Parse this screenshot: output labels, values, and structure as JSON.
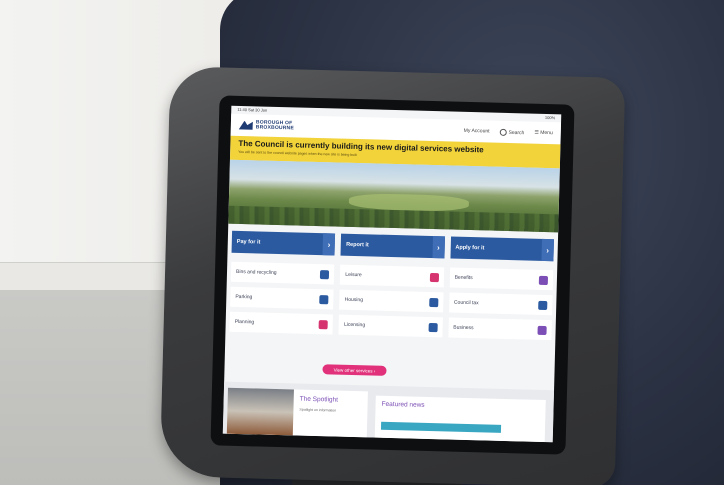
{
  "status": {
    "time": "11:40 Sat 30 Jun",
    "battery": "100%"
  },
  "header": {
    "logo_line1": "BOROUGH OF",
    "logo_line2": "BROXBOURNE",
    "nav": [
      "My Account",
      "Search",
      "Menu"
    ]
  },
  "banner": {
    "title": "The Council is currently building its new digital services website",
    "subtitle": "You will be sent to the council website pages when the new site is being built"
  },
  "actions": [
    "Pay for it",
    "Report it",
    "Apply for it"
  ],
  "services": [
    {
      "label": "Bins and recycling",
      "icon": "bin-icon"
    },
    {
      "label": "Leisure",
      "icon": "swimmer-icon"
    },
    {
      "label": "Benefits",
      "icon": "piggy-bank-icon"
    },
    {
      "label": "Parking",
      "icon": "parking-icon"
    },
    {
      "label": "Housing",
      "icon": "house-icon"
    },
    {
      "label": "Council tax",
      "icon": "house-coin-icon"
    },
    {
      "label": "Planning",
      "icon": "map-icon"
    },
    {
      "label": "Licensing",
      "icon": "id-card-icon"
    },
    {
      "label": "Business",
      "icon": "bar-chart-icon"
    }
  ],
  "more_button": "View other services",
  "spotlight": {
    "title": "The Spotlight",
    "subtitle": "Spotlight on information"
  },
  "news": {
    "title": "Featured news"
  },
  "colors": {
    "brand": "#1f3b73",
    "banner": "#f2d33a",
    "action": "#2c5aa0",
    "accent": "#e0317a",
    "heading": "#7b4fb5"
  }
}
